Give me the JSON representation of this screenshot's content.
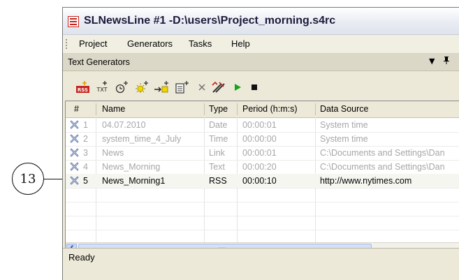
{
  "window": {
    "title": "SLNewsLine #1 -D:\\users\\Project_morning.s4rc"
  },
  "menu": {
    "items": [
      "Project",
      "Generators",
      "Tasks",
      "Help"
    ]
  },
  "panel": {
    "title": "Text Generators",
    "pin_glyph": "▾  ╨"
  },
  "toolbar": {
    "icons": [
      "add-rss-icon",
      "add-txt-icon",
      "add-time-icon",
      "add-date-icon",
      "add-link-icon",
      "add-text-list-icon",
      "delete-icon",
      "properties-icon",
      "play-icon",
      "stop-icon"
    ],
    "rss_text": "RSS",
    "txt_text": "TXT"
  },
  "table": {
    "columns": [
      "#",
      "Name",
      "Type",
      "Period (h:m:s)",
      "Data Source"
    ],
    "rows": [
      {
        "num": "1",
        "name": "04.07.2010",
        "type": "Date",
        "period": "00:00:01",
        "source": "System time",
        "enabled": false
      },
      {
        "num": "2",
        "name": "system_time_4_July",
        "type": "Time",
        "period": "00:00:00",
        "source": "System time",
        "enabled": false
      },
      {
        "num": "3",
        "name": "News",
        "type": "Link",
        "period": "00:00:01",
        "source": "C:\\Documents and Settings\\Dan",
        "enabled": false
      },
      {
        "num": "4",
        "name": "News_Morning",
        "type": "Text",
        "period": "00:00:20",
        "source": "C:\\Documents and Settings\\Dan",
        "enabled": false
      },
      {
        "num": "5",
        "name": "News_Morning1",
        "type": "RSS",
        "period": "00:00:10",
        "source": "http://www.nytimes.com",
        "enabled": true
      }
    ]
  },
  "status": {
    "text": "Ready"
  },
  "callout": {
    "label": "13"
  },
  "colors": {
    "accent": "#c4241e",
    "row_icon": "#5a6f9c",
    "play": "#1aa31a"
  }
}
